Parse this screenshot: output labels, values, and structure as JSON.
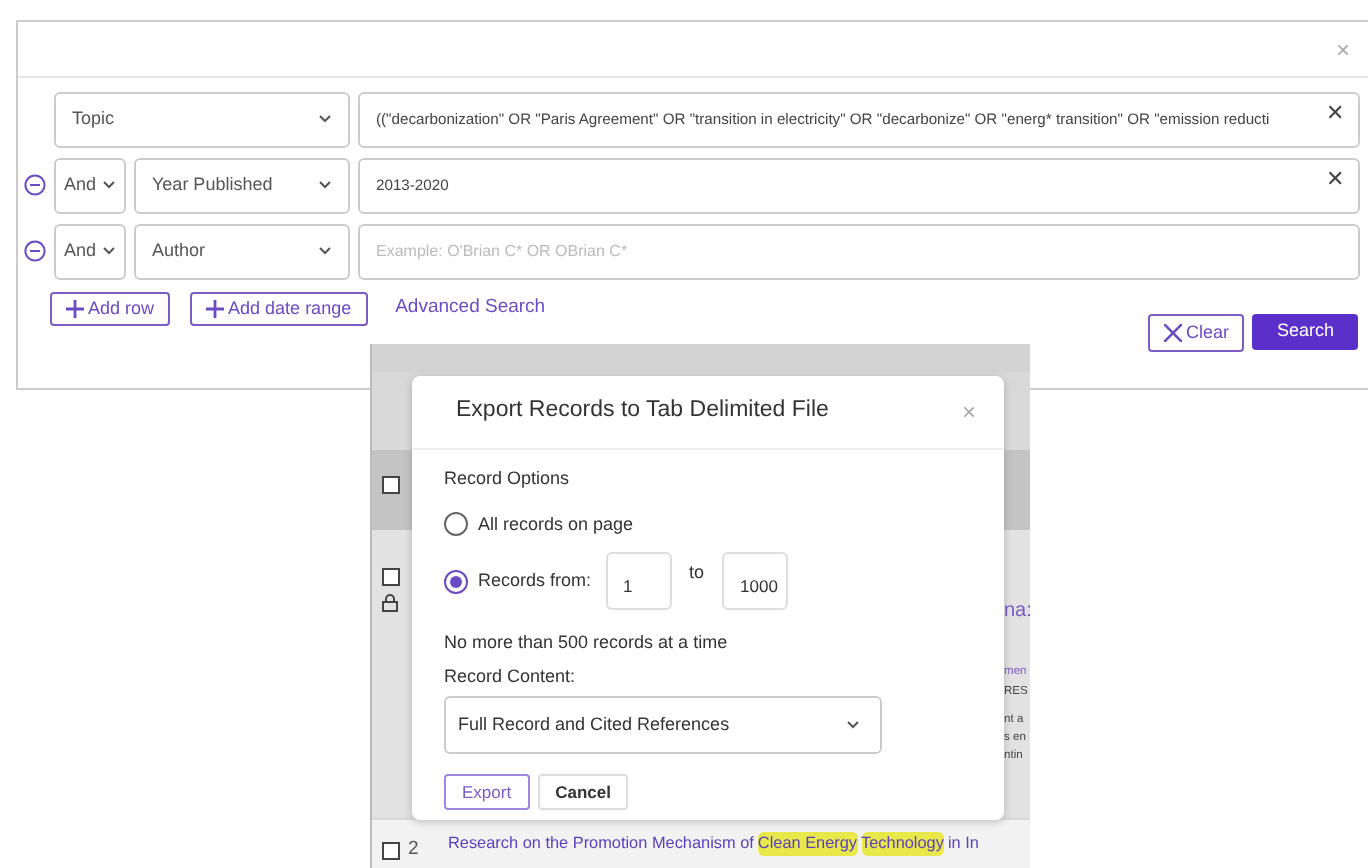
{
  "search_panel": {
    "close": "×",
    "rows": [
      {
        "operator": null,
        "field": "Topic",
        "value": "((\"decarbonization\" OR \"Paris Agreement\" OR \"transition in electricity\" OR \"decarbonize\" OR \"energ* transition\" OR \"emission reducti",
        "clear": "✕",
        "removable": false
      },
      {
        "operator": "And",
        "field": "Year Published",
        "value": "2013-2020",
        "clear": "✕",
        "removable": true
      },
      {
        "operator": "And",
        "field": "Author",
        "placeholder": "Example: O'Brian C* OR OBrian C*",
        "removable": true
      }
    ],
    "add_row": "Add row",
    "add_date_range": "Add date range",
    "advanced_search": "Advanced Search",
    "clear_button": "Clear",
    "search_button": "Search"
  },
  "results_behind": {
    "rows": [
      {
        "checked": false,
        "fragments": []
      },
      {
        "checked": false,
        "locked": true,
        "fragments": [
          {
            "text": "na:",
            "kind": "title"
          },
          {
            "text": "men",
            "kind": "link"
          },
          {
            "text": "RES",
            "kind": "plain"
          },
          {
            "text": "nt a",
            "kind": "plain"
          },
          {
            "text": "s en",
            "kind": "plain"
          },
          {
            "text": "ntin",
            "kind": "plain"
          }
        ]
      },
      {
        "checked": false,
        "number": "2",
        "title": [
          {
            "text": "Research on the Promotion Mechanism of",
            "highlighted": false
          },
          {
            "text": "Clean Energy",
            "highlighted": true
          },
          {
            "text": "Technology",
            "highlighted": true
          },
          {
            "text": "in In",
            "highlighted": false
          }
        ]
      }
    ]
  },
  "export_dialog": {
    "title": "Export Records to Tab Delimited File",
    "close": "×",
    "section": "Record Options",
    "options": [
      {
        "label": "All records on page",
        "selected": false
      },
      {
        "label": "Records from:",
        "selected": true
      }
    ],
    "from": "1",
    "to_label": "to",
    "to": "1000",
    "note": "No more than 500 records at a time",
    "content_label": "Record Content:",
    "content": "Full Record and Cited References",
    "buttons": [
      {
        "label": "Export",
        "kind": "primary"
      },
      {
        "label": "Cancel",
        "kind": "secondary"
      }
    ]
  }
}
